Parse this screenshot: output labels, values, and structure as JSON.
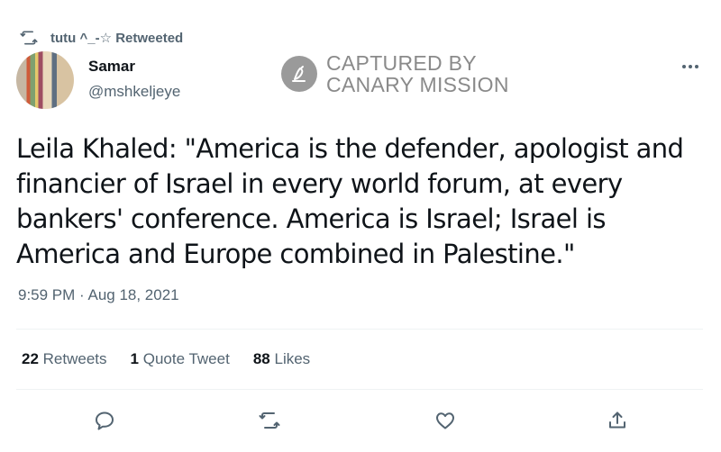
{
  "retweet_context": {
    "icon": "retweet-icon",
    "text": "tutu ^_-☆ Retweeted"
  },
  "author": {
    "display_name": "Samar",
    "handle": "@mshkeljeye"
  },
  "watermark": {
    "line1": "CAPTURED BY",
    "line2": "CANARY MISSION"
  },
  "tweet": {
    "text": "Leila Khaled: \"America is the defender, apologist and financier of Israel in every world forum, at every bankers' conference. America is Israel; Israel is America and Europe combined in Palestine.\"",
    "timestamp": "9:59 PM · Aug 18, 2021"
  },
  "stats": {
    "retweets_count": "22",
    "retweets_label": "Retweets",
    "quotes_count": "1",
    "quotes_label": "Quote Tweet",
    "likes_count": "88",
    "likes_label": "Likes"
  },
  "actions": [
    "reply-icon",
    "retweet-icon",
    "like-icon",
    "share-icon"
  ],
  "colors": {
    "text_primary": "#0f1419",
    "text_secondary": "#536471",
    "divider": "#eff3f4",
    "watermark": "#8a8a8a"
  }
}
